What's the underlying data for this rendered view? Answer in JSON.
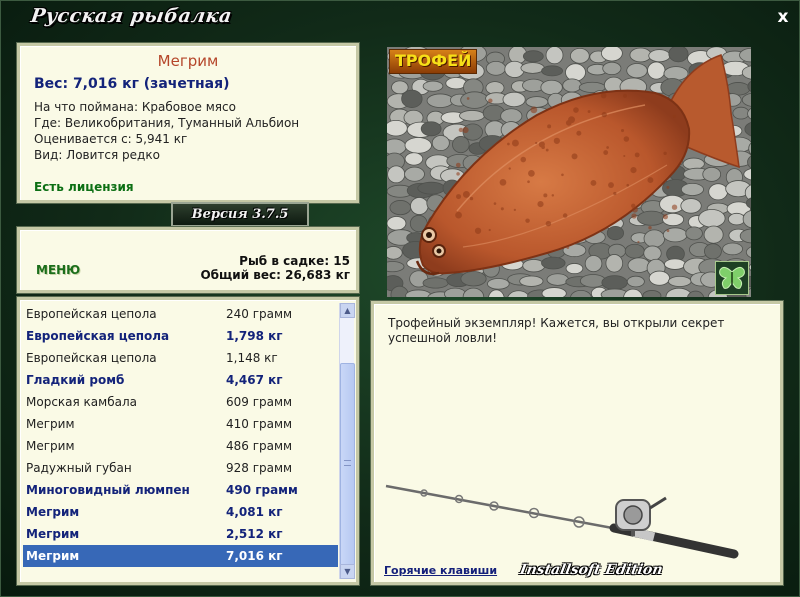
{
  "app": {
    "title": "Русская рыбалка",
    "close": "x",
    "version": "Версия 3.7.5"
  },
  "info": {
    "name": "Мегрим",
    "weight": "Вес: 7,016 кг (зачетная)",
    "lines": [
      "На что поймана: Крабовое мясо",
      "Где: Великобритания, Туманный Альбион",
      "Оценивается с: 5,941 кг",
      "Вид: Ловится редко"
    ],
    "license": "Есть лицензия"
  },
  "menu": {
    "label": "МЕНЮ"
  },
  "stats": {
    "count": "Рыб в садке: 15",
    "total": "Общий вес: 26,683 кг"
  },
  "image": {
    "badge": "ТРОФЕЙ",
    "butterfly_icon": "butterfly-icon"
  },
  "list": {
    "rows": [
      {
        "name": "Европейская цеполa",
        "weight": "240 грамм",
        "style": "normal"
      },
      {
        "name": "Европейская цепола",
        "weight": "1,798 кг",
        "style": "bold"
      },
      {
        "name": "Европейская цепола",
        "weight": "1,148 кг",
        "style": "normal"
      },
      {
        "name": "Гладкий ромб",
        "weight": "4,467 кг",
        "style": "bold"
      },
      {
        "name": "Морская камбала",
        "weight": "609 грамм",
        "style": "normal"
      },
      {
        "name": "Мегрим",
        "weight": "410 грамм",
        "style": "normal"
      },
      {
        "name": "Мегрим",
        "weight": "486 грамм",
        "style": "normal"
      },
      {
        "name": "Радужный губан",
        "weight": "928 грамм",
        "style": "normal"
      },
      {
        "name": "Миноговидный люмпен",
        "weight": "490 грамм",
        "style": "bold"
      },
      {
        "name": "Мегрим",
        "weight": "4,081 кг",
        "style": "bold"
      },
      {
        "name": "Мегрим",
        "weight": "2,512 кг",
        "style": "bold"
      },
      {
        "name": "Мегрим",
        "weight": "7,016 кг",
        "style": "selected"
      }
    ]
  },
  "message": {
    "text": "Трофейный экземпляр! Кажется, вы открыли секрет успешной ловли!",
    "hotkeys": "Горячие клавиши",
    "edition": "Installsoft Edition"
  },
  "colors": {
    "accent": "#3768b7",
    "panel": "#fafae6",
    "name": "#b5462a",
    "bold_text": "#13237a",
    "license": "#0c6f14"
  }
}
